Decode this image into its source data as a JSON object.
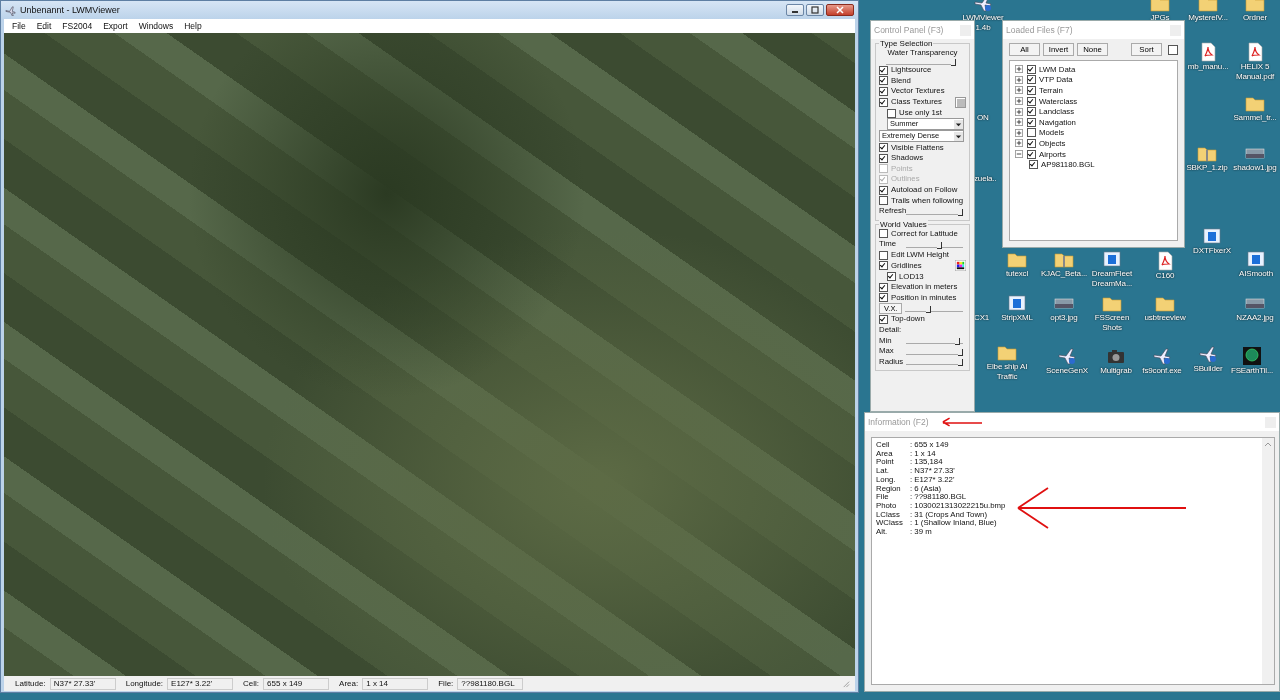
{
  "main_window": {
    "title": "Unbenannt - LWMViewer",
    "menu": [
      "File",
      "Edit",
      "FS2004",
      "Export",
      "Windows",
      "Help"
    ],
    "status_bar": [
      {
        "label": "Latitude:",
        "value": "N37* 27.33'"
      },
      {
        "label": "Longitude:",
        "value": "E127* 3.22'"
      },
      {
        "label": "Cell:",
        "value": "655 x 149"
      },
      {
        "label": "Area:",
        "value": "1 x 14"
      },
      {
        "label": "File:",
        "value": "??981180.BGL"
      }
    ]
  },
  "desktop_icons": [
    {
      "label": "LWMViewer 1.4b",
      "kind": "plane"
    },
    {
      "label": "JPGs",
      "kind": "folder"
    },
    {
      "label": "MysterelV...",
      "kind": "folder"
    },
    {
      "label": "Ordner",
      "kind": "folder"
    },
    {
      "label": "mb_manu...",
      "kind": "pdf"
    },
    {
      "label": "HELIX 5 Manual.pdf",
      "kind": "pdf"
    },
    {
      "label": "Sammel_tr...",
      "kind": "folder"
    },
    {
      "label": "ON",
      "kind": "partial"
    },
    {
      "label": "zuela..",
      "kind": "partial"
    },
    {
      "label": "SBKP_1.zip",
      "kind": "zip"
    },
    {
      "label": "shadow1.jpg",
      "kind": "image"
    },
    {
      "label": "DXTFixerX",
      "kind": "app"
    },
    {
      "label": "tutexcl",
      "kind": "folder"
    },
    {
      "label": "KJAC_Beta...",
      "kind": "zip"
    },
    {
      "label": "DreamFleet DreamMa...",
      "kind": "app"
    },
    {
      "label": "C160",
      "kind": "pdf"
    },
    {
      "label": "AISmooth",
      "kind": "app"
    },
    {
      "label": "CX1",
      "kind": "partial"
    },
    {
      "label": "StripXML",
      "kind": "app"
    },
    {
      "label": "opt3.jpg",
      "kind": "image"
    },
    {
      "label": "FSScreen Shots",
      "kind": "folder"
    },
    {
      "label": "usbtreeview",
      "kind": "folder"
    },
    {
      "label": "NZAA2.jpg",
      "kind": "image"
    },
    {
      "label": "Elbe ship AI Traffic",
      "kind": "folder"
    },
    {
      "label": "SceneGenX",
      "kind": "plane"
    },
    {
      "label": "Multigrab",
      "kind": "camera"
    },
    {
      "label": "fs9conf.exe",
      "kind": "plane"
    },
    {
      "label": "SBuilder",
      "kind": "plane"
    },
    {
      "label": "FSEarthTil...",
      "kind": "globe"
    }
  ],
  "control_panel": {
    "title": "Control Panel (F3)",
    "sections": [
      {
        "title": "Type Selection",
        "rows": [
          {
            "kind": "slider",
            "label": "Water Transparency",
            "level": 1
          },
          {
            "kind": "checkbox",
            "label": "Lightsource",
            "checked": true,
            "disabled": false
          },
          {
            "kind": "checkbox",
            "label": "Blend",
            "checked": true,
            "disabled": false
          },
          {
            "kind": "checkbox",
            "label": "Vector Textures",
            "checked": true,
            "disabled": false
          },
          {
            "kind": "checkbox_swatch",
            "label": "Class Textures",
            "checked": true,
            "disabled": false,
            "children": [
              {
                "kind": "checkbox",
                "label": "Use only 1st",
                "checked": false,
                "disabled": false
              },
              {
                "kind": "dropdown",
                "value": "Summer"
              }
            ]
          },
          {
            "kind": "dropdown",
            "value": "Extremely Dense"
          },
          {
            "kind": "checkbox",
            "label": "Visible Flattens",
            "checked": true,
            "disabled": false
          },
          {
            "kind": "checkbox",
            "label": "Shadows",
            "checked": true,
            "disabled": false
          },
          {
            "kind": "checkbox",
            "label": "Points",
            "checked": false,
            "disabled": true
          },
          {
            "kind": "checkbox",
            "label": "Outlines",
            "checked": true,
            "disabled": true
          },
          {
            "kind": "checkbox",
            "label": "Autoload on Follow",
            "checked": true,
            "disabled": false
          },
          {
            "kind": "checkbox",
            "label": "Trails when following",
            "checked": false,
            "disabled": false
          },
          {
            "kind": "inline_slider",
            "label": "Refresh",
            "level": 1
          }
        ]
      },
      {
        "title": "World Values",
        "rows": [
          {
            "kind": "checkbox",
            "label": "Correct for Latitude",
            "checked": false,
            "disabled": false
          },
          {
            "kind": "inline_slider",
            "label": "Time",
            "level": 0.6
          },
          {
            "kind": "checkbox",
            "label": "Edit LWM Height",
            "checked": false,
            "disabled": false
          },
          {
            "kind": "checkbox_palette",
            "label": "Gridlines",
            "checked": true,
            "disabled": false,
            "children": [
              {
                "kind": "checkbox",
                "label": "LOD13",
                "checked": true,
                "disabled": false
              }
            ]
          },
          {
            "kind": "checkbox",
            "label": "Elevation in meters",
            "checked": true,
            "disabled": false
          },
          {
            "kind": "checkbox",
            "label": "Position in minutes",
            "checked": true,
            "disabled": false
          },
          {
            "kind": "button_slider",
            "label": "V.X.",
            "level": 0.4
          },
          {
            "kind": "checkbox",
            "label": "Top-down",
            "checked": true,
            "disabled": false
          },
          {
            "kind": "label",
            "label": "Detail:"
          },
          {
            "kind": "inline_slider",
            "label": "Min",
            "level": 0.95
          },
          {
            "kind": "inline_slider",
            "label": "Max",
            "level": 1
          },
          {
            "kind": "inline_slider",
            "label": "Radius",
            "level": 1
          }
        ]
      }
    ]
  },
  "loaded_files": {
    "title": "Loaded Files (F7)",
    "buttons": [
      "All",
      "Invert",
      "None"
    ],
    "sort_button": "Sort",
    "sort_checked": false,
    "tree": [
      {
        "label": "LWM Data",
        "checked": true,
        "expanded": false
      },
      {
        "label": "VTP Data",
        "checked": true,
        "expanded": false
      },
      {
        "label": "Terrain",
        "checked": true,
        "expanded": false
      },
      {
        "label": "Waterclass",
        "checked": true,
        "expanded": false
      },
      {
        "label": "Landclass",
        "checked": true,
        "expanded": false
      },
      {
        "label": "Navigation",
        "checked": true,
        "expanded": false
      },
      {
        "label": "Models",
        "checked": false,
        "expanded": false
      },
      {
        "label": "Objects",
        "checked": true,
        "expanded": false
      },
      {
        "label": "Airports",
        "checked": true,
        "expanded": true,
        "children": [
          {
            "label": "AP981180.BGL",
            "checked": true
          }
        ]
      }
    ]
  },
  "information": {
    "title": "Information (F2)",
    "rows": [
      {
        "label": "Cell",
        "value": ": 655 x 149"
      },
      {
        "label": "Area",
        "value": ": 1 x 14"
      },
      {
        "label": "Point",
        "value": ": 135,184"
      },
      {
        "label": "Lat.",
        "value": ": N37* 27.33'"
      },
      {
        "label": "Long.",
        "value": ": E127* 3.22'"
      },
      {
        "label": "Region",
        "value": ": 6 (Asia)"
      },
      {
        "label": "File",
        "value": ": ??981180.BGL"
      },
      {
        "label": "Photo",
        "value": ": 1030021313022215u.bmp"
      },
      {
        "label": "LClass",
        "value": ": 31 (Crops And Town)"
      },
      {
        "label": "WClass",
        "value": ": 1 (Shallow Inland, Blue)"
      },
      {
        "label": "Alt.",
        "value": ": 39 m"
      }
    ]
  }
}
